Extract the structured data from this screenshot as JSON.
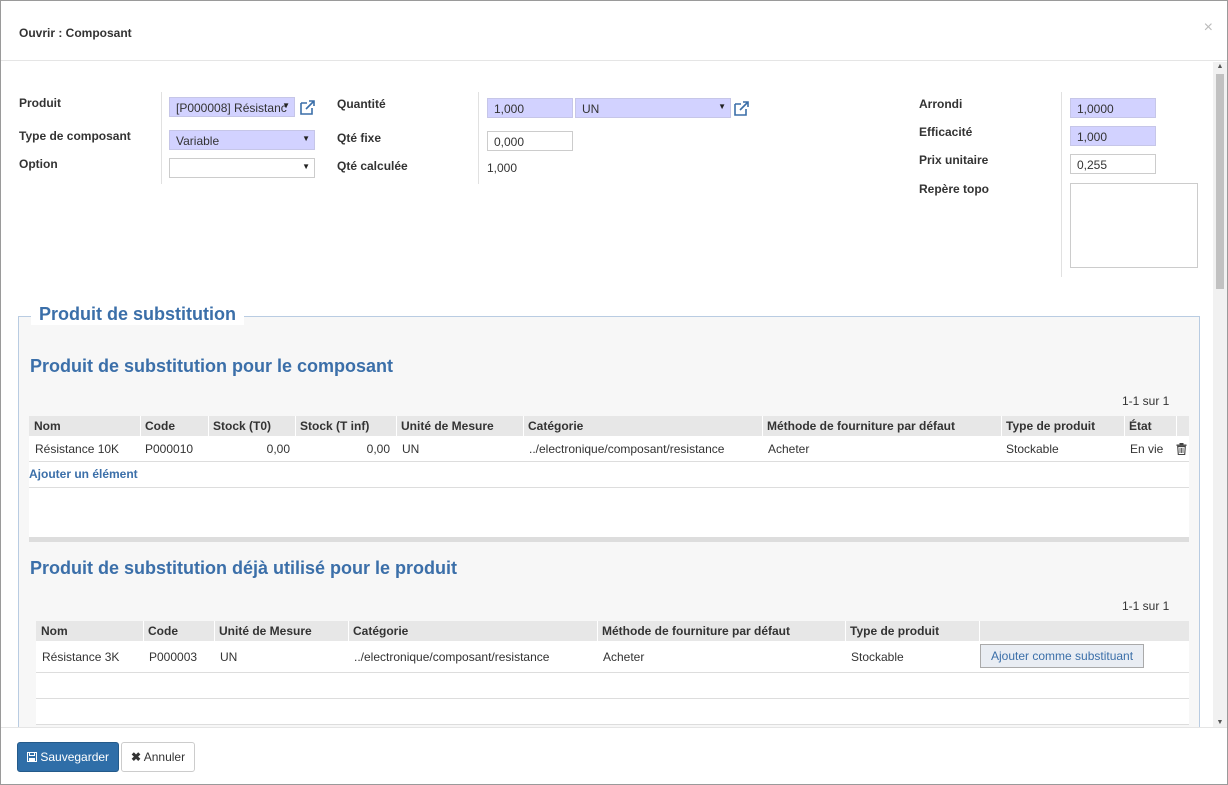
{
  "dialog": {
    "title": "Ouvrir : Composant",
    "close_glyph": "×"
  },
  "form": {
    "produit": {
      "label": "Produit",
      "value": "[P000008] Résistanc"
    },
    "type_composant": {
      "label": "Type de composant",
      "value": "Variable"
    },
    "option": {
      "label": "Option",
      "value": ""
    },
    "quantite": {
      "label": "Quantité",
      "value": "1,000",
      "uom": "UN"
    },
    "qte_fixe": {
      "label": "Qté fixe",
      "value": "0,000"
    },
    "qte_calculee": {
      "label": "Qté calculée",
      "value": "1,000"
    },
    "arrondi": {
      "label": "Arrondi",
      "value": "1,0000"
    },
    "efficacite": {
      "label": "Efficacité",
      "value": "1,000"
    },
    "prix_unitaire": {
      "label": "Prix unitaire",
      "value": "0,255"
    },
    "repere_topo": {
      "label": "Repère topo",
      "value": ""
    }
  },
  "substitution": {
    "legend": "Produit de substitution",
    "section1": {
      "title": "Produit de substitution pour le composant",
      "pager": "1-1 sur 1",
      "columns": [
        "Nom",
        "Code",
        "Stock (T0)",
        "Stock (T inf)",
        "Unité de Mesure",
        "Catégorie",
        "Méthode de fourniture par défaut",
        "Type de produit",
        "État"
      ],
      "rows": [
        [
          "Résistance 10K",
          "P000010",
          "0,00",
          "0,00",
          "UN",
          "../electronique/composant/resistance",
          "Acheter",
          "Stockable",
          "En vie"
        ]
      ],
      "add_item": "Ajouter un élément"
    },
    "section2": {
      "title": "Produit de substitution déjà utilisé pour le produit",
      "pager": "1-1 sur 1",
      "columns": [
        "Nom",
        "Code",
        "Unité de Mesure",
        "Catégorie",
        "Méthode de fourniture par défaut",
        "Type de produit"
      ],
      "rows": [
        [
          "Résistance 3K",
          "P000003",
          "UN",
          "../electronique/composant/resistance",
          "Acheter",
          "Stockable"
        ]
      ],
      "row_action": "Ajouter comme substituant"
    }
  },
  "footer": {
    "save": "Sauvegarder",
    "cancel": "Annuler"
  },
  "colors": {
    "accent": "#3b6fa9",
    "required_field": "#d2d2ff",
    "primary_button": "#2f6ea8"
  }
}
